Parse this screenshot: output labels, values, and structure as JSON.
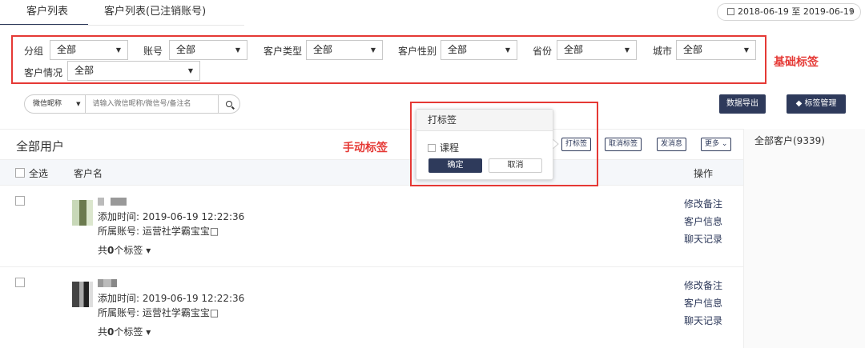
{
  "tabs": [
    {
      "label": "客户列表"
    },
    {
      "label": "客户列表(已注销账号)"
    }
  ],
  "date_range": "2018-06-19 至 2019-06-19",
  "filters": {
    "group": {
      "label": "分组",
      "value": "全部"
    },
    "account": {
      "label": "账号",
      "value": "全部"
    },
    "customer_type": {
      "label": "客户类型",
      "value": "全部"
    },
    "gender": {
      "label": "客户性别",
      "value": "全部"
    },
    "province": {
      "label": "省份",
      "value": "全部"
    },
    "city": {
      "label": "城市",
      "value": "全部"
    },
    "situation": {
      "label": "客户情况",
      "value": "全部"
    }
  },
  "annotations": {
    "basic_tags": "基础标签",
    "manual_tags": "手动标签"
  },
  "search": {
    "type": "微信昵称",
    "placeholder": "请输入微信昵称/微信号/备注名"
  },
  "toolbar": {
    "export": "数据导出",
    "tag_manage": "标签管理"
  },
  "list": {
    "title": "全部用户",
    "actions": {
      "tag": "打标签",
      "untag": "取消标签",
      "message": "发消息",
      "more": "更多"
    },
    "select_all": "全选",
    "col_name": "客户名",
    "col_ops": "操作"
  },
  "rows": [
    {
      "added": "添加时间:  2019-06-19 12:22:36",
      "account": "所属账号:  运营社学霸宝宝□",
      "tags_prefix": "共",
      "tags_count": "0",
      "tags_suffix": "个标签",
      "ops": [
        "修改备注",
        "客户信息",
        "聊天记录"
      ]
    },
    {
      "added": "添加时间:  2019-06-19 12:22:36",
      "account": "所属账号:  运营社学霸宝宝□",
      "tags_prefix": "共",
      "tags_count": "0",
      "tags_suffix": "个标签",
      "ops": [
        "修改备注",
        "客户信息",
        "聊天记录"
      ]
    }
  ],
  "right_panel": {
    "all_customers": "全部客户(9339)"
  },
  "popup": {
    "title": "打标签",
    "option": "课程",
    "confirm": "确定",
    "cancel": "取消"
  }
}
